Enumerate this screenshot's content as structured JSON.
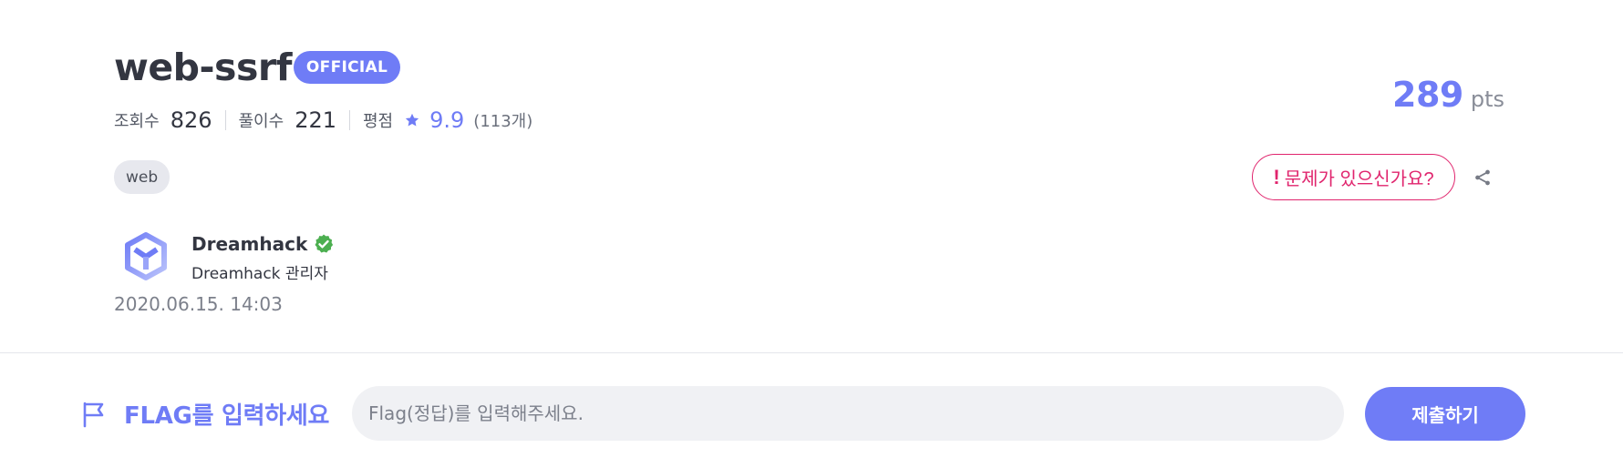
{
  "challenge": {
    "title": "web-ssrf",
    "badge": "OFFICIAL",
    "stats": {
      "views_label": "조회수",
      "views_value": "826",
      "solves_label": "풀이수",
      "solves_value": "221",
      "rating_label": "평점",
      "rating_value": "9.9",
      "rating_count": "(113개)"
    },
    "tag": "web",
    "points_value": "289",
    "points_unit": "pts",
    "report_button": "문제가 있으신가요?",
    "report_bang": "!"
  },
  "author": {
    "name": "Dreamhack",
    "role": "Dreamhack 관리자",
    "date": "2020.06.15. 14:03"
  },
  "flag": {
    "label": "FLAG를 입력하세요",
    "placeholder": "Flag(정답)를 입력해주세요.",
    "submit_label": "제출하기"
  },
  "icons": {
    "star": "star-icon",
    "verified": "verified-check-icon",
    "share": "share-icon",
    "flag": "flag-icon",
    "avatar": "dreamhack-logo"
  },
  "colors": {
    "accent": "#6f7cf6",
    "report": "#e0246d",
    "verified": "#4caf50"
  }
}
